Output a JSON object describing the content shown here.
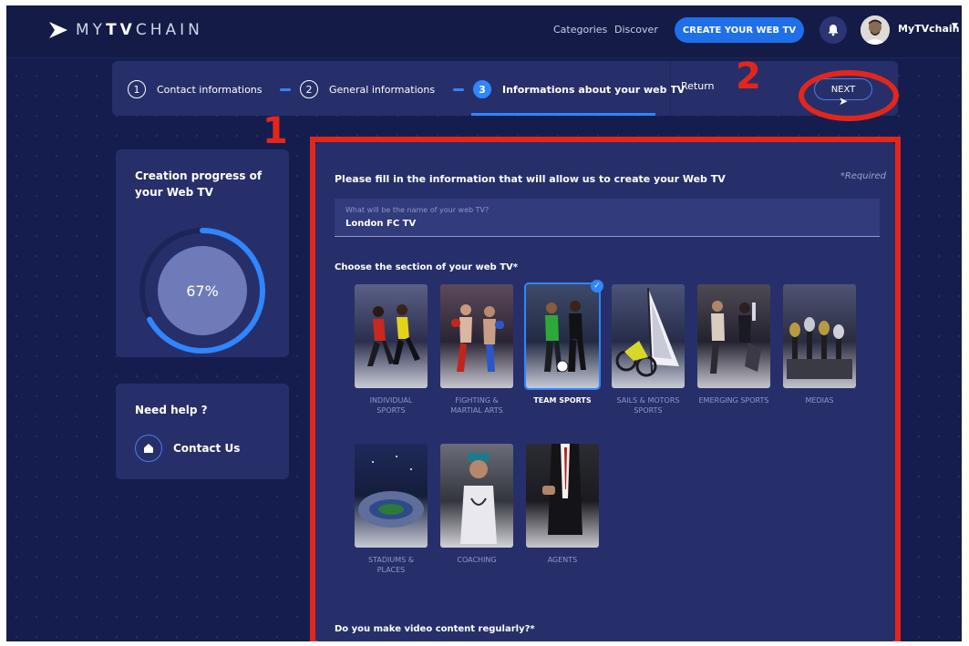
{
  "header": {
    "logo_text_thin_1": "MY",
    "logo_text_bold": "TV",
    "logo_text_thin_2": "CHAIN",
    "nav": [
      "Categories",
      "Discover"
    ],
    "cta_label": "CREATE YOUR WEB TV",
    "bell_icon": "bell-icon",
    "username": "MyTVchain"
  },
  "stepper": {
    "steps": [
      {
        "num": "1",
        "label": "Contact informations"
      },
      {
        "num": "2",
        "label": "General informations"
      },
      {
        "num": "3",
        "label": "Informations about your web TV"
      }
    ],
    "return_label": "Return",
    "next_label": "NEXT"
  },
  "annotations": {
    "label_1": "1",
    "label_2": "2",
    "color": "#e3261b"
  },
  "progress": {
    "title": "Creation progress of your Web TV",
    "value": 67,
    "value_text": "67%"
  },
  "help": {
    "title": "Need help ?",
    "contact_label": "Contact Us"
  },
  "form": {
    "heading": "Please fill in the information that will allow us to create your Web TV",
    "required_note": "*Required",
    "name_placeholder": "What will be the name of your web TV?",
    "name_value": "London FC TV",
    "section_label": "Choose the section of your web TV*",
    "sections": [
      {
        "label": "INDIVIDUAL SPORTS",
        "selected": false
      },
      {
        "label": "FIGHTING & MARTIAL ARTS",
        "selected": false
      },
      {
        "label": "TEAM SPORTS",
        "selected": true
      },
      {
        "label": "SAILS & MOTORS SPORTS",
        "selected": false
      },
      {
        "label": "EMERGING SPORTS",
        "selected": false
      },
      {
        "label": "MEDIAS",
        "selected": false
      },
      {
        "label": "STADIUMS & PLACES",
        "selected": false
      },
      {
        "label": "COACHING",
        "selected": false
      },
      {
        "label": "AGENTS",
        "selected": false
      }
    ],
    "video_question": "Do you make video content regularly?*"
  },
  "colors": {
    "background": "#151d4e",
    "card": "#272f6a",
    "accent": "#2f86ff",
    "cta": "#1f6fe8"
  }
}
